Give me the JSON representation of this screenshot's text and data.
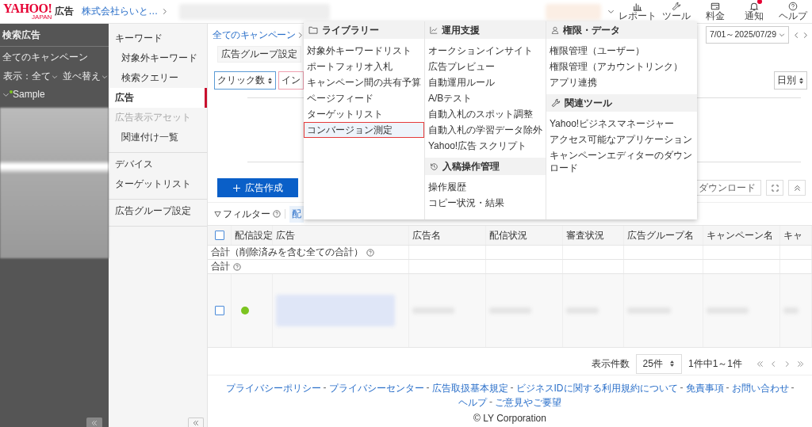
{
  "header": {
    "logo": "YAHOO!",
    "logo_sub": "JAPAN",
    "product": "広告",
    "account": "株式会社らいと…",
    "nav": [
      {
        "kind": "report",
        "label": "レポート",
        "badge": false
      },
      {
        "kind": "tool",
        "label": "ツール",
        "badge": false
      },
      {
        "kind": "billing",
        "label": "料金",
        "badge": false
      },
      {
        "kind": "notice",
        "label": "通知",
        "badge": true
      },
      {
        "kind": "help",
        "label": "ヘルプ",
        "badge": false
      }
    ]
  },
  "account_sidebar": {
    "title": "検索広告",
    "all_campaigns": "全てのキャンペーン",
    "filter": "表示：全て",
    "sort": "並べ替え",
    "campaigns": [
      {
        "label": "Sample",
        "expanded": true,
        "color": "#7cc420"
      }
    ]
  },
  "nav_sidebar": {
    "groups": [
      {
        "items": [
          {
            "label": "キーワード",
            "selected": false,
            "disabled": false,
            "children": [
              {
                "label": "対象外キーワード",
                "selected": false,
                "disabled": false
              },
              {
                "label": "検索クエリー",
                "selected": false,
                "disabled": false
              }
            ]
          },
          {
            "label": "広告",
            "selected": true,
            "disabled": false
          },
          {
            "label": "広告表示アセット",
            "selected": false,
            "disabled": true,
            "children": [
              {
                "label": "関連付け一覧",
                "selected": false,
                "disabled": false
              }
            ]
          }
        ]
      },
      {
        "items": [
          {
            "label": "デバイス",
            "selected": false,
            "disabled": false
          },
          {
            "label": "ターゲットリスト",
            "selected": false,
            "disabled": false
          }
        ]
      },
      {
        "items": [
          {
            "label": "広告グループ設定",
            "selected": false,
            "disabled": false
          }
        ]
      }
    ]
  },
  "main": {
    "breadcrumb": [
      "全てのキャンペーン"
    ],
    "date_range": "7/01～2025/07/29",
    "adgroup_settings": "広告グループ設定",
    "metrics": [
      {
        "label": "クリック数",
        "color": "#5b9bd5"
      },
      {
        "label": "イン",
        "color": "#f0a0b0"
      }
    ],
    "granularity": "日別",
    "create_button": "広告作成",
    "download_button": "ダウンロード",
    "filter": "フィルター",
    "filter_chip": "配"
  },
  "table": {
    "all_checked": false,
    "columns": [
      "配信設定",
      "広告",
      "広告名",
      "配信状況",
      "審査状況",
      "広告グループ名",
      "キャンペーン名",
      "キャ"
    ],
    "summary_rows": [
      "合計（削除済みを含む全ての合計）",
      "合計"
    ],
    "rows": [
      {
        "checked": false,
        "color": "#7cc420"
      }
    ]
  },
  "pagination": {
    "label": "表示件数",
    "per_page": "25件",
    "range": "1件中1～1件"
  },
  "footer": {
    "links": [
      "プライバシーポリシー",
      "プライバシーセンター",
      "広告取扱基本規定",
      "ビジネスIDに関する利用規約について",
      "免責事項",
      "お問い合わせ",
      "ヘルプ",
      "ご意見やご要望"
    ],
    "separator": "-",
    "copyright": "© LY Corporation"
  },
  "menu": {
    "columns": [
      {
        "sections": [
          {
            "title": "ライブラリー",
            "items": [
              {
                "label": "対象外キーワードリスト",
                "selected": false
              },
              {
                "label": "ポートフォリオ入札",
                "selected": false
              },
              {
                "label": "キャンペーン間の共有予算",
                "selected": false
              },
              {
                "label": "ページフィード",
                "selected": false
              },
              {
                "label": "ターゲットリスト",
                "selected": false
              },
              {
                "label": "コンバージョン測定",
                "selected": true
              }
            ]
          }
        ]
      },
      {
        "sections": [
          {
            "title": "運用支援",
            "items": [
              {
                "label": "オークションインサイト",
                "selected": false
              },
              {
                "label": "広告プレビュー",
                "selected": false
              },
              {
                "label": "自動運用ルール",
                "selected": false
              },
              {
                "label": "A/Bテスト",
                "selected": false
              },
              {
                "label": "自動入札のスポット調整",
                "selected": false
              },
              {
                "label": "自動入札の学習データ除外",
                "selected": false
              },
              {
                "label": "Yahoo!広告 スクリプト",
                "selected": false
              }
            ]
          },
          {
            "title": "入稿操作管理",
            "items": [
              {
                "label": "操作履歴",
                "selected": false
              },
              {
                "label": "コピー状況・結果",
                "selected": false
              }
            ]
          }
        ]
      },
      {
        "sections": [
          {
            "title": "権限・データ",
            "items": [
              {
                "label": "権限管理（ユーザー）",
                "selected": false
              },
              {
                "label": "権限管理（アカウントリンク）",
                "selected": false
              },
              {
                "label": "アプリ連携",
                "selected": false
              }
            ]
          },
          {
            "title": "関連ツール",
            "items": [
              {
                "label": "Yahoo!ビジネスマネージャー",
                "selected": false
              },
              {
                "label": "アクセス可能なアプリケーション",
                "selected": false
              },
              {
                "label": "キャンペーンエディターのダウンロード",
                "selected": false
              }
            ]
          }
        ]
      }
    ]
  }
}
